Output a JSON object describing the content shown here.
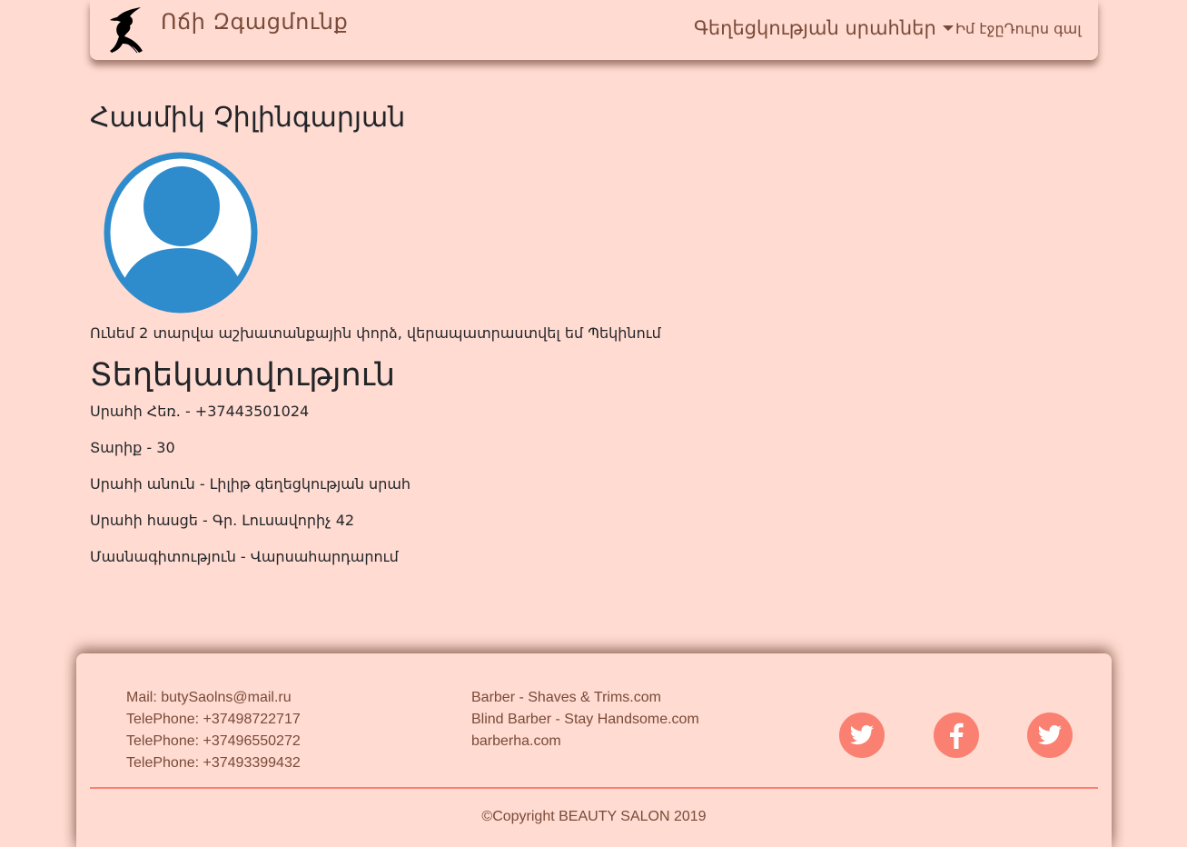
{
  "header": {
    "brand": "Ոճի Զգացմունք",
    "logo_icon": "woman-silhouette-logo-icon",
    "nav_dropdown_label": "Գեղեցկության սրահներ",
    "nav_page_label": "Իմ էջըԴուրս գալ"
  },
  "profile": {
    "name": "Հասմիկ Չիլինգարյան",
    "avatar_icon": "user-avatar-icon",
    "bio": "Ունեմ 2 տարվա աշխատանքային փորձ, վերապատրաստվել եմ Պեկինում",
    "info_title": "Տեղեկատվություն",
    "info": [
      "Սրահի Հեռ. - +37443501024",
      "Տարիք - 30",
      "Սրահի անուն - Լիլիթ գեղեցկության սրահ",
      "Սրահի հասցե - Գր. Լուսավորիչ 42",
      "Մասնագիտություն - Վարսահարդարում"
    ]
  },
  "footer": {
    "contacts": [
      "Mail: butySaolns@mail.ru",
      "TelePhone: +37498722717",
      "TelePhone: +37496550272",
      "TelePhone: +37493399432"
    ],
    "links": [
      "Barber - Shaves & Trims.com",
      "Blind Barber - Stay Handsome.com",
      "barberha.com"
    ],
    "social_icons": [
      "twitter-icon",
      "facebook-icon",
      "twitter-icon"
    ],
    "copyright": "©Copyright BEAUTY SALON 2019"
  },
  "colors": {
    "background": "#ffdbd1",
    "accent": "#fa8072",
    "avatar_blue": "#2e8bcc",
    "nav_text": "#7a4a38"
  }
}
